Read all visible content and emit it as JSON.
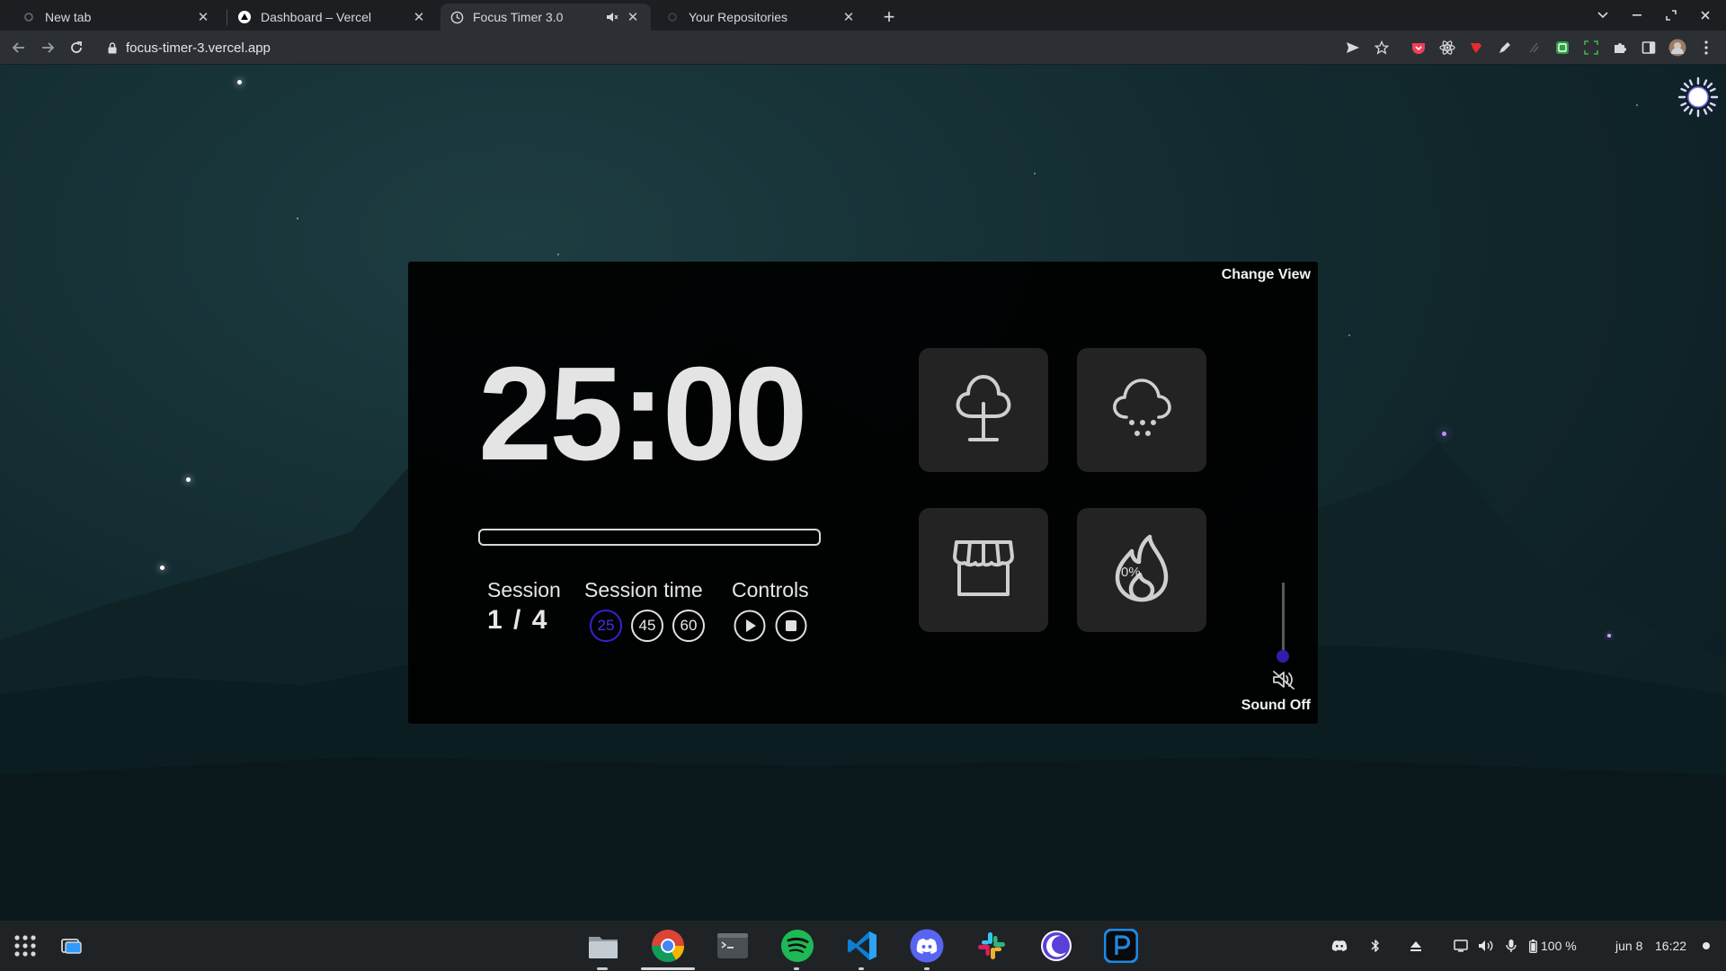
{
  "browser": {
    "tabs": [
      {
        "title": "New tab"
      },
      {
        "title": "Dashboard – Vercel"
      },
      {
        "title": "Focus Timer 3.0",
        "active": true,
        "audio": "muted"
      },
      {
        "title": "Your Repositories"
      }
    ],
    "url": "focus-timer-3.vercel.app"
  },
  "app": {
    "change_view": "Change View",
    "timer": "25:00",
    "progress_fraction": 0,
    "session": {
      "label": "Session",
      "value": "1 / 4"
    },
    "session_time": {
      "label": "Session time",
      "options": [
        "25",
        "45",
        "60"
      ],
      "selected": "25"
    },
    "controls": {
      "label": "Controls",
      "buttons": [
        "play-icon",
        "stop-icon"
      ]
    },
    "sounds": [
      "tree-icon",
      "rain-cloud-icon",
      "store-icon",
      "fire-icon"
    ],
    "volume": {
      "percent": "0%",
      "level": 0
    },
    "sound_status": "Sound Off"
  },
  "taskbar": {
    "apps": [
      "files-icon",
      "chrome-icon",
      "terminal-icon",
      "spotify-icon",
      "vscode-icon",
      "discord-icon",
      "slack-icon",
      "moon-icon",
      "pycharm-icon"
    ],
    "battery": "100 %",
    "date": "jun 8",
    "time": "16:22"
  },
  "colors": {
    "accent": "#3b1fd6",
    "card": "#000000",
    "tile": "#232323"
  }
}
